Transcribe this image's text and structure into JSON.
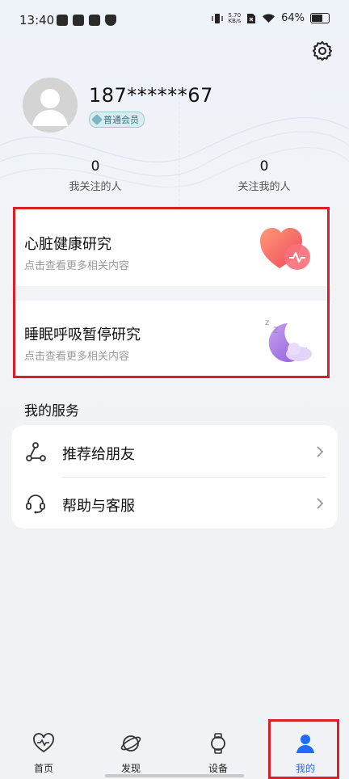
{
  "status_bar": {
    "time": "13:40",
    "net_speed_value": "5.70",
    "net_speed_unit": "KB/s",
    "battery": "64%"
  },
  "profile": {
    "username": "187******67",
    "member_badge": "普通会员",
    "stats": [
      {
        "count": "0",
        "label": "我关注的人"
      },
      {
        "count": "0",
        "label": "关注我的人"
      }
    ]
  },
  "research": [
    {
      "title": "心脏健康研究",
      "subtitle": "点击查看更多相关内容",
      "icon": "heart-icon"
    },
    {
      "title": "睡眠呼吸暂停研究",
      "subtitle": "点击查看更多相关内容",
      "icon": "moon-icon"
    }
  ],
  "services": {
    "title": "我的服务",
    "items": [
      {
        "label": "推荐给朋友",
        "icon": "share-icon"
      },
      {
        "label": "帮助与客服",
        "icon": "headset-icon"
      }
    ]
  },
  "nav": [
    {
      "label": "首页",
      "icon": "heart-pulse-icon"
    },
    {
      "label": "发现",
      "icon": "planet-icon"
    },
    {
      "label": "设备",
      "icon": "watch-icon"
    },
    {
      "label": "我的",
      "icon": "person-icon"
    }
  ],
  "colors": {
    "accent": "#1f6bff",
    "highlight_frame": "#d9202a"
  }
}
